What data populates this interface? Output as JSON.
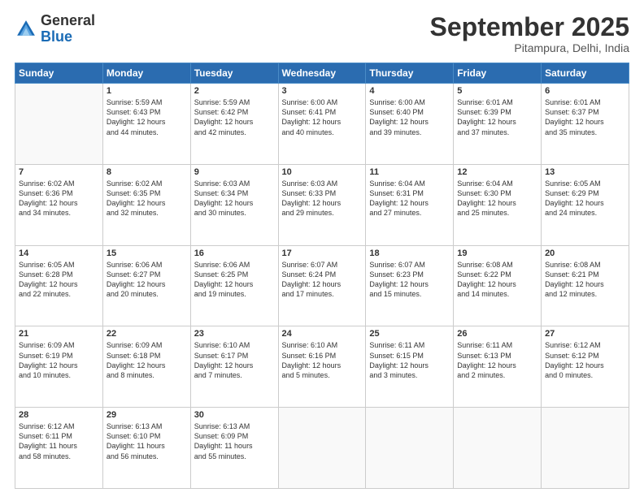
{
  "header": {
    "logo_general": "General",
    "logo_blue": "Blue",
    "month": "September 2025",
    "location": "Pitampura, Delhi, India"
  },
  "days_of_week": [
    "Sunday",
    "Monday",
    "Tuesday",
    "Wednesday",
    "Thursday",
    "Friday",
    "Saturday"
  ],
  "weeks": [
    [
      {
        "day": "",
        "detail": ""
      },
      {
        "day": "1",
        "detail": "Sunrise: 5:59 AM\nSunset: 6:43 PM\nDaylight: 12 hours\nand 44 minutes."
      },
      {
        "day": "2",
        "detail": "Sunrise: 5:59 AM\nSunset: 6:42 PM\nDaylight: 12 hours\nand 42 minutes."
      },
      {
        "day": "3",
        "detail": "Sunrise: 6:00 AM\nSunset: 6:41 PM\nDaylight: 12 hours\nand 40 minutes."
      },
      {
        "day": "4",
        "detail": "Sunrise: 6:00 AM\nSunset: 6:40 PM\nDaylight: 12 hours\nand 39 minutes."
      },
      {
        "day": "5",
        "detail": "Sunrise: 6:01 AM\nSunset: 6:39 PM\nDaylight: 12 hours\nand 37 minutes."
      },
      {
        "day": "6",
        "detail": "Sunrise: 6:01 AM\nSunset: 6:37 PM\nDaylight: 12 hours\nand 35 minutes."
      }
    ],
    [
      {
        "day": "7",
        "detail": "Sunrise: 6:02 AM\nSunset: 6:36 PM\nDaylight: 12 hours\nand 34 minutes."
      },
      {
        "day": "8",
        "detail": "Sunrise: 6:02 AM\nSunset: 6:35 PM\nDaylight: 12 hours\nand 32 minutes."
      },
      {
        "day": "9",
        "detail": "Sunrise: 6:03 AM\nSunset: 6:34 PM\nDaylight: 12 hours\nand 30 minutes."
      },
      {
        "day": "10",
        "detail": "Sunrise: 6:03 AM\nSunset: 6:33 PM\nDaylight: 12 hours\nand 29 minutes."
      },
      {
        "day": "11",
        "detail": "Sunrise: 6:04 AM\nSunset: 6:31 PM\nDaylight: 12 hours\nand 27 minutes."
      },
      {
        "day": "12",
        "detail": "Sunrise: 6:04 AM\nSunset: 6:30 PM\nDaylight: 12 hours\nand 25 minutes."
      },
      {
        "day": "13",
        "detail": "Sunrise: 6:05 AM\nSunset: 6:29 PM\nDaylight: 12 hours\nand 24 minutes."
      }
    ],
    [
      {
        "day": "14",
        "detail": "Sunrise: 6:05 AM\nSunset: 6:28 PM\nDaylight: 12 hours\nand 22 minutes."
      },
      {
        "day": "15",
        "detail": "Sunrise: 6:06 AM\nSunset: 6:27 PM\nDaylight: 12 hours\nand 20 minutes."
      },
      {
        "day": "16",
        "detail": "Sunrise: 6:06 AM\nSunset: 6:25 PM\nDaylight: 12 hours\nand 19 minutes."
      },
      {
        "day": "17",
        "detail": "Sunrise: 6:07 AM\nSunset: 6:24 PM\nDaylight: 12 hours\nand 17 minutes."
      },
      {
        "day": "18",
        "detail": "Sunrise: 6:07 AM\nSunset: 6:23 PM\nDaylight: 12 hours\nand 15 minutes."
      },
      {
        "day": "19",
        "detail": "Sunrise: 6:08 AM\nSunset: 6:22 PM\nDaylight: 12 hours\nand 14 minutes."
      },
      {
        "day": "20",
        "detail": "Sunrise: 6:08 AM\nSunset: 6:21 PM\nDaylight: 12 hours\nand 12 minutes."
      }
    ],
    [
      {
        "day": "21",
        "detail": "Sunrise: 6:09 AM\nSunset: 6:19 PM\nDaylight: 12 hours\nand 10 minutes."
      },
      {
        "day": "22",
        "detail": "Sunrise: 6:09 AM\nSunset: 6:18 PM\nDaylight: 12 hours\nand 8 minutes."
      },
      {
        "day": "23",
        "detail": "Sunrise: 6:10 AM\nSunset: 6:17 PM\nDaylight: 12 hours\nand 7 minutes."
      },
      {
        "day": "24",
        "detail": "Sunrise: 6:10 AM\nSunset: 6:16 PM\nDaylight: 12 hours\nand 5 minutes."
      },
      {
        "day": "25",
        "detail": "Sunrise: 6:11 AM\nSunset: 6:15 PM\nDaylight: 12 hours\nand 3 minutes."
      },
      {
        "day": "26",
        "detail": "Sunrise: 6:11 AM\nSunset: 6:13 PM\nDaylight: 12 hours\nand 2 minutes."
      },
      {
        "day": "27",
        "detail": "Sunrise: 6:12 AM\nSunset: 6:12 PM\nDaylight: 12 hours\nand 0 minutes."
      }
    ],
    [
      {
        "day": "28",
        "detail": "Sunrise: 6:12 AM\nSunset: 6:11 PM\nDaylight: 11 hours\nand 58 minutes."
      },
      {
        "day": "29",
        "detail": "Sunrise: 6:13 AM\nSunset: 6:10 PM\nDaylight: 11 hours\nand 56 minutes."
      },
      {
        "day": "30",
        "detail": "Sunrise: 6:13 AM\nSunset: 6:09 PM\nDaylight: 11 hours\nand 55 minutes."
      },
      {
        "day": "",
        "detail": ""
      },
      {
        "day": "",
        "detail": ""
      },
      {
        "day": "",
        "detail": ""
      },
      {
        "day": "",
        "detail": ""
      }
    ]
  ]
}
